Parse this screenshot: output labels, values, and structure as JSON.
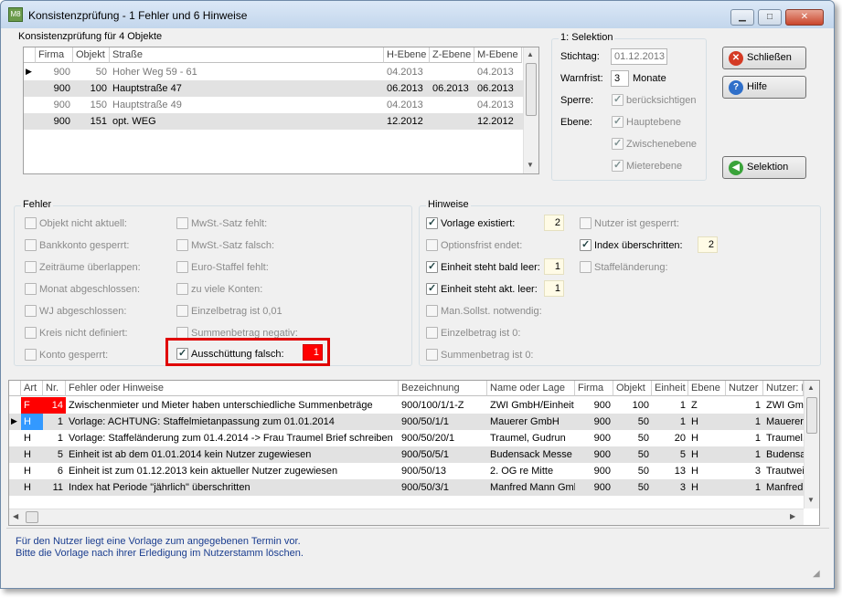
{
  "window": {
    "title": "Konsistenzprüfung - 1 Fehler und 6 Hinweise",
    "icon_text": "M8",
    "buttons": {
      "minimize": "▁",
      "maximize": "□",
      "close": "✕"
    }
  },
  "objects_table": {
    "caption": "Konsistenzprüfung für 4 Objekte",
    "headers": [
      "Firma",
      "Objekt",
      "Straße",
      "H-Ebene",
      "Z-Ebene",
      "M-Ebene"
    ],
    "rows": [
      {
        "firma": "900",
        "objekt": "50",
        "strasse": "Hoher Weg 59 - 61",
        "h": "04.2013",
        "z": "",
        "m": "04.2013",
        "dim": true,
        "current": true
      },
      {
        "firma": "900",
        "objekt": "100",
        "strasse": "Hauptstraße 47",
        "h": "06.2013",
        "z": "06.2013",
        "m": "06.2013",
        "dim": false,
        "current": false
      },
      {
        "firma": "900",
        "objekt": "150",
        "strasse": "Hauptstraße 49",
        "h": "04.2013",
        "z": "",
        "m": "04.2013",
        "dim": true,
        "current": false
      },
      {
        "firma": "900",
        "objekt": "151",
        "strasse": "opt. WEG",
        "h": "12.2012",
        "z": "",
        "m": "12.2012",
        "dim": false,
        "current": false
      }
    ]
  },
  "selektion": {
    "group_label": "1: Selektion",
    "stichtag_label": "Stichtag:",
    "stichtag_value": "01.12.2013",
    "warnfrist_label": "Warnfrist:",
    "warnfrist_value": "3",
    "warnfrist_unit": "Monate",
    "sperre_label": "Sperre:",
    "sperre_option": "berücksichtigen",
    "ebene_label": "Ebene:",
    "ebene_options": [
      "Hauptebene",
      "Zwischenebene",
      "Mieterebene"
    ]
  },
  "buttons": {
    "close_label": "Schließen",
    "help_label": "Hilfe",
    "selection_label": "Selektion"
  },
  "fehler": {
    "group_label": "Fehler",
    "col1": [
      "Objekt nicht aktuell:",
      "Bankkonto gesperrt:",
      "Zeiträume überlappen:",
      "Monat abgeschlossen:",
      "WJ abgeschlossen:",
      "Kreis nicht definiert:",
      "Konto gesperrt:"
    ],
    "col2": [
      "MwSt.-Satz fehlt:",
      "MwSt.-Satz falsch:",
      "Euro-Staffel fehlt:",
      "zu viele Konten:",
      "Einzelbetrag ist 0,01",
      "Summenbetrag negativ:"
    ],
    "highlight_label": "Ausschüttung falsch:",
    "highlight_count": "1"
  },
  "hinweise": {
    "group_label": "Hinweise",
    "col1": [
      {
        "label": "Vorlage existiert:",
        "checked": true,
        "count": "2"
      },
      {
        "label": "Optionsfrist endet:",
        "checked": false,
        "count": ""
      },
      {
        "label": "Einheit steht bald leer:",
        "checked": true,
        "count": "1"
      },
      {
        "label": "Einheit steht akt. leer:",
        "checked": true,
        "count": "1"
      },
      {
        "label": "Man.Sollst. notwendig:",
        "checked": false,
        "count": ""
      },
      {
        "label": "Einzelbetrag ist 0:",
        "checked": false,
        "count": ""
      },
      {
        "label": "Summenbetrag ist 0:",
        "checked": false,
        "count": ""
      }
    ],
    "col2": [
      {
        "label": "Nutzer ist gesperrt:",
        "checked": false,
        "count": ""
      },
      {
        "label": "Index überschritten:",
        "checked": true,
        "count": "2"
      },
      {
        "label": "Staffeländerung:",
        "checked": false,
        "count": ""
      }
    ]
  },
  "results_table": {
    "headers": [
      "Art",
      "Nr.",
      "Fehler oder Hinweise",
      "Bezeichnung",
      "Name oder Lage",
      "Firma",
      "Objekt",
      "Einheit",
      "Ebene",
      "Nutzer",
      "Nutzer: N"
    ],
    "rows": [
      {
        "art": "F",
        "nr": "14",
        "text": "Zwischenmieter und Mieter haben unterschiedliche Summenbeträge",
        "bez": "900/100/1/1-Z",
        "name": "ZWI GmbH/Einheit",
        "firma": "900",
        "objekt": "100",
        "einheit": "1",
        "ebene": "Z",
        "nutzer": "1",
        "nname": "ZWI Gm"
      },
      {
        "art": "H",
        "nr": "1",
        "text": "Vorlage: ACHTUNG: Staffelmietanpassung zum 01.01.2014",
        "bez": "900/50/1/1",
        "name": "Mauerer GmbH",
        "firma": "900",
        "objekt": "50",
        "einheit": "1",
        "ebene": "H",
        "nutzer": "1",
        "nname": "Mauerer"
      },
      {
        "art": "H",
        "nr": "1",
        "text": "Vorlage: Staffeländerung zum 01.4.2014 -> Frau Traumel Brief schreiben",
        "bez": "900/50/20/1",
        "name": "Traumel, Gudrun",
        "firma": "900",
        "objekt": "50",
        "einheit": "20",
        "ebene": "H",
        "nutzer": "1",
        "nname": "Traumel,"
      },
      {
        "art": "H",
        "nr": "5",
        "text": "Einheit ist ab dem 01.01.2014 kein Nutzer zugewiesen",
        "bez": "900/50/5/1",
        "name": "Budensack Messe l",
        "firma": "900",
        "objekt": "50",
        "einheit": "5",
        "ebene": "H",
        "nutzer": "1",
        "nname": "Budensa"
      },
      {
        "art": "H",
        "nr": "6",
        "text": "Einheit ist zum 01.12.2013 kein aktueller Nutzer zugewiesen",
        "bez": "900/50/13",
        "name": "2. OG re Mitte",
        "firma": "900",
        "objekt": "50",
        "einheit": "13",
        "ebene": "H",
        "nutzer": "3",
        "nname": "Trautwei"
      },
      {
        "art": "H",
        "nr": "11",
        "text": "Index hat Periode \"jährlich\" überschritten",
        "bez": "900/50/3/1",
        "name": "Manfred Mann Gmb",
        "firma": "900",
        "objekt": "50",
        "einheit": "3",
        "ebene": "H",
        "nutzer": "1",
        "nname": "Manfred"
      }
    ]
  },
  "footer": {
    "line1": "Für den Nutzer liegt eine Vorlage zum angegebenen Termin vor.",
    "line2": "Bitte die Vorlage nach ihrer Erledigung im Nutzerstamm löschen."
  },
  "colors": {
    "error_red": "#ff0000",
    "info_blue": "#3399ff",
    "footer_text": "#1a3d8f",
    "highlight_border": "#e00000"
  },
  "icons": {
    "close": "red-x-icon",
    "help": "question-icon",
    "selection": "green-arrow-icon",
    "sort": "sort-az-icon"
  }
}
